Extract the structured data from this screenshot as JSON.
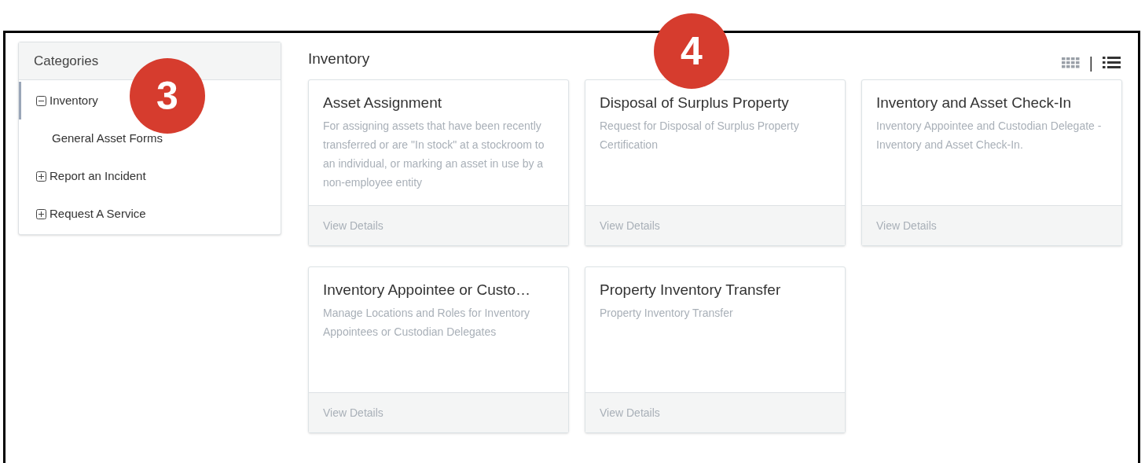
{
  "sidebar": {
    "title": "Categories",
    "items": [
      {
        "label": "Inventory",
        "expanded": true,
        "selected": true,
        "children": [
          {
            "label": "General Asset Forms",
            "selected": false
          }
        ]
      },
      {
        "label": "Report an Incident",
        "expanded": false,
        "selected": false
      },
      {
        "label": "Request A Service",
        "expanded": false,
        "selected": false
      }
    ]
  },
  "main": {
    "title": "Inventory",
    "view_options": [
      {
        "kind": "grid",
        "selected": false
      },
      {
        "kind": "list",
        "selected": true
      }
    ],
    "separator": "|",
    "cards": [
      {
        "title": "Asset Assignment",
        "description": "For assigning assets that have been recently transferred or are \"In stock\" at a stockroom to an individual, or marking an asset in use by a non-employee entity",
        "action": "View Details"
      },
      {
        "title": "Disposal of Surplus Property",
        "description": "Request for Disposal of Surplus Property Certification",
        "action": "View Details"
      },
      {
        "title": "Inventory and Asset Check-In",
        "description": "Inventory Appointee and Custodian Delegate - Inventory and Asset Check-In.",
        "action": "View Details"
      },
      {
        "title": "Inventory Appointee or Custo…",
        "description": "Manage Locations and Roles for Inventory Appointees or Custodian Delegates",
        "action": "View Details"
      },
      {
        "title": "Property Inventory Transfer",
        "description": "Property Inventory Transfer",
        "action": "View Details"
      }
    ]
  },
  "callouts": [
    {
      "label": "3"
    },
    {
      "label": "4"
    }
  ]
}
